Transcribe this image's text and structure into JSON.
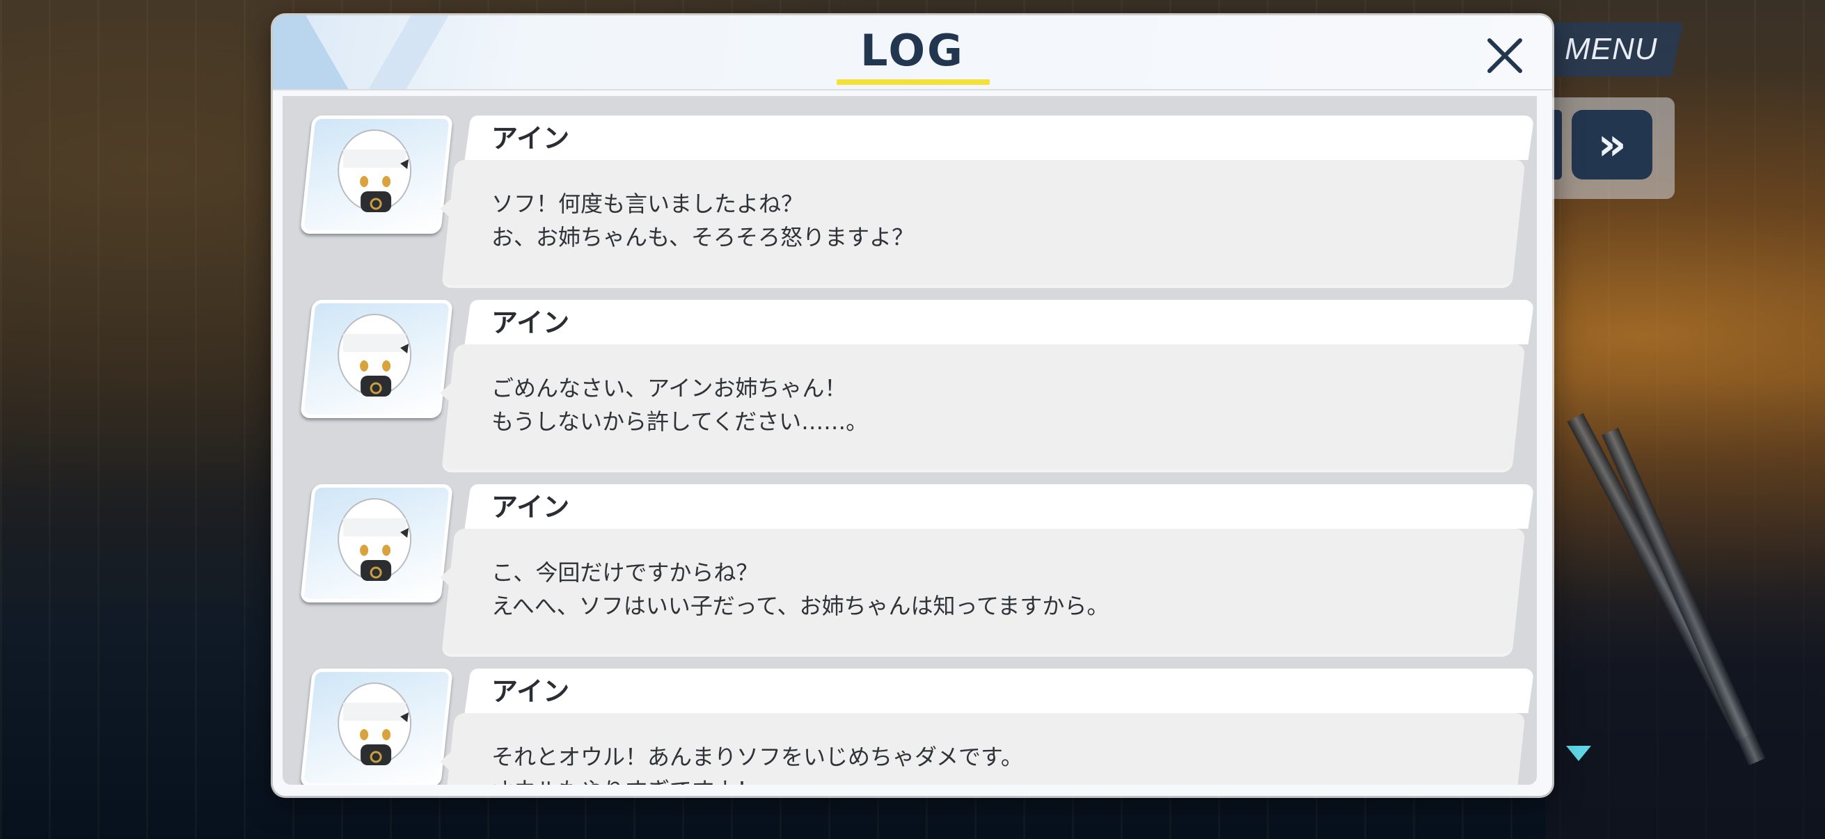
{
  "background": {
    "menu_label": "MENU",
    "skip_label": "»"
  },
  "modal": {
    "title": "LOG",
    "close_icon": "close-icon",
    "accent": "#f3e03a"
  },
  "entries": [
    {
      "speaker": "アイン",
      "lines": [
        "ソフ！何度も言いましたよね？",
        "お、お姉ちゃんも、そろそろ怒りますよ？"
      ]
    },
    {
      "speaker": "アイン",
      "lines": [
        "ごめんなさい、アインお姉ちゃん！",
        "もうしないから許してください……。"
      ]
    },
    {
      "speaker": "アイン",
      "lines": [
        "こ、今回だけですからね？",
        "えへへ、ソフはいい子だって、お姉ちゃんは知ってますから。"
      ]
    },
    {
      "speaker": "アイン",
      "lines": [
        "それとオウル！あんまりソフをいじめちゃダメです。",
        "オウルもやりすぎですよ！"
      ]
    }
  ]
}
